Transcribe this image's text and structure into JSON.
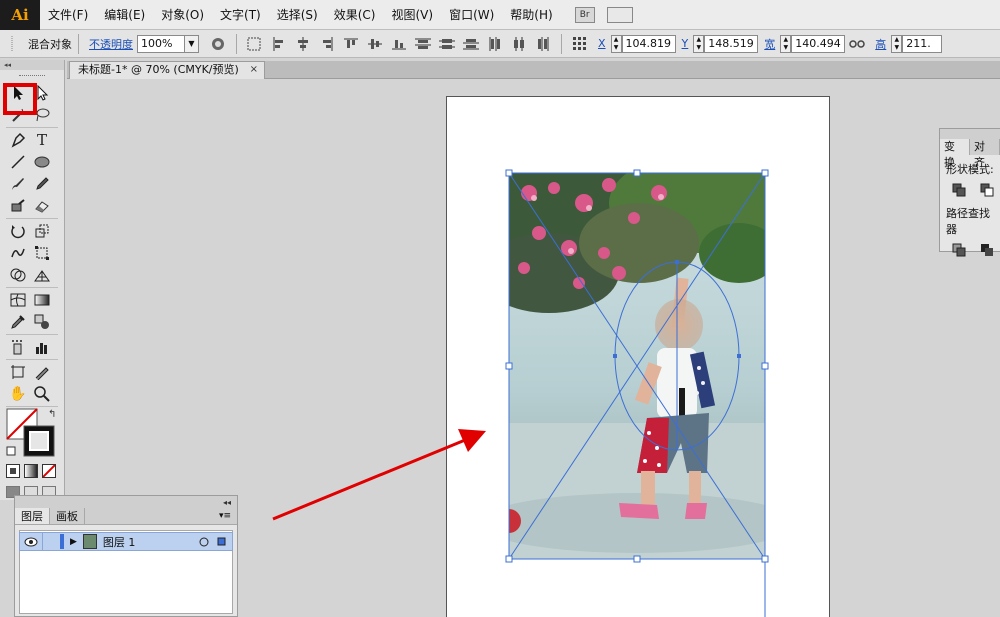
{
  "app": {
    "logo": "Ai"
  },
  "menu": [
    "文件(F)",
    "编辑(E)",
    "对象(O)",
    "文字(T)",
    "选择(S)",
    "效果(C)",
    "视图(V)",
    "窗口(W)",
    "帮助(H)"
  ],
  "menubar_icons": {
    "bridge": "Br",
    "workspace": "workspace-switcher-icon"
  },
  "controlbar": {
    "selection_type": "混合对象",
    "opacity_label": "不透明度",
    "opacity_value": "100%",
    "x_label": "X",
    "x_value": "104.819",
    "y_label": "Y",
    "y_value": "148.519",
    "w_label": "宽",
    "w_value": "140.494",
    "h_label": "高",
    "h_value": "211."
  },
  "document": {
    "tab_title": "未标题-1* @ 70% (CMYK/预览)",
    "close": "×"
  },
  "pathfinder": {
    "tabs": [
      "变换",
      "对齐"
    ],
    "shape_modes_label": "形状模式:",
    "pathfinders_label": "路径查找器"
  },
  "layers": {
    "tabs": [
      "图层",
      "画板"
    ],
    "rows": [
      {
        "name": "图层 1"
      }
    ],
    "collapse": "◂◂"
  },
  "tools_header": "◂◂",
  "colors": {
    "highlight": "#e10000",
    "arrow": "#e10000",
    "selection": "#3c6fd6",
    "layer_row": "#bcd0ef"
  }
}
